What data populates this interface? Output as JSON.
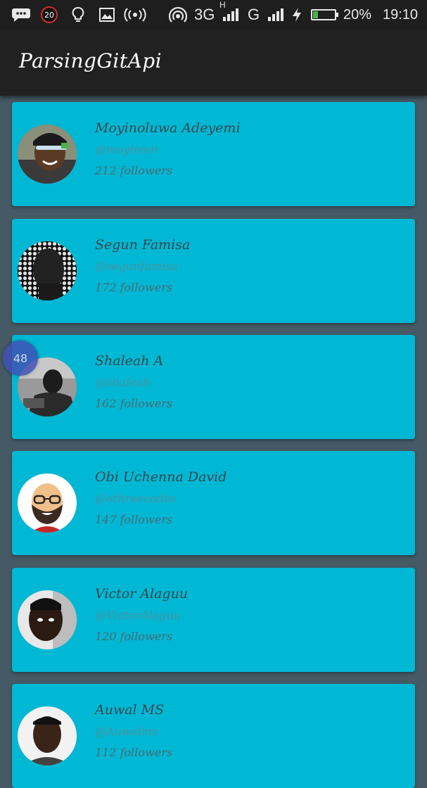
{
  "status_bar": {
    "notification_count": "20",
    "network_type": "3G",
    "network_sub": "H",
    "carrier_g": "G",
    "battery_percent": "20%",
    "time": "19:10"
  },
  "app_bar": {
    "title": "ParsingGitApi"
  },
  "floating_bubble": {
    "value": "48"
  },
  "users": [
    {
      "name": "Moyinoluwa Adeyemi",
      "handle": "@moyheen",
      "followers": "212 followers"
    },
    {
      "name": "Segun Famisa",
      "handle": "@segunfamisa",
      "followers": "172 followers"
    },
    {
      "name": "Shaleah A",
      "handle": "@shaleah",
      "followers": "162 followers"
    },
    {
      "name": "Obi Uchenna David",
      "handle": "@othreecodes",
      "followers": "147 followers"
    },
    {
      "name": "Victor Alaguu",
      "handle": "@VictorAlaguu",
      "followers": "120 followers"
    },
    {
      "name": "Auwal MS",
      "handle": "@Auwalms",
      "followers": "112 followers"
    }
  ],
  "colors": {
    "card": "#00b8d4",
    "background": "#455a64",
    "app_bar": "#212121"
  }
}
